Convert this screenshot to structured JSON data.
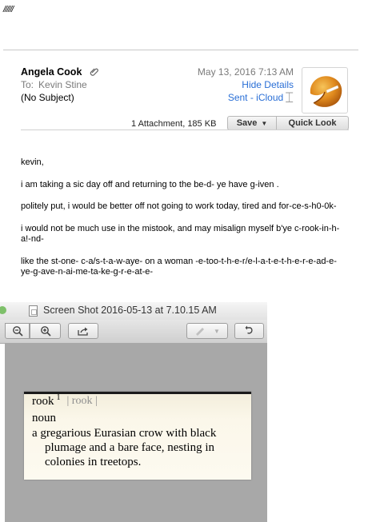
{
  "page_marks": "//////",
  "email": {
    "sender": "Angela Cook",
    "to_label": "To:",
    "to_value": "Kevin Stine",
    "subject": "(No Subject)",
    "date": "May 13, 2016",
    "time": "7:13 AM",
    "hide_details": "Hide Details",
    "sent_folder": "Sent - iCloud",
    "attachment_info": "1 Attachment, 185 KB",
    "save_label": "Save",
    "quick_look_label": "Quick Look",
    "body": [
      "kevin,",
      "i am taking a sic day off and returning to the  be-d- ye have g-iven .",
      "politely put, i would be better off not going to work today, tired and for-ce-s-h0-0k-",
      "i would not be much use in the mistook, and may misalign myself b'ye c-rook-in-h-a!-nd-",
      "like the st-one- c-a/s-t-a-w-aye- on a woman -e-too-t-h-e-r/e-l-a-t-e-t-h-e-r-e-ad-e-ye-g-ave-n-ai-me-ta-ke-g-r-e-at-e-"
    ]
  },
  "preview_window": {
    "title": "Screen Shot 2016-05-13 at 7.10.15 AM",
    "dictionary": {
      "headword": "rook",
      "superscript": "1",
      "pronunciation": "| rook |",
      "part_of_speech": "noun",
      "definition": "a gregarious Eurasian crow with black plumage and a bare face, nesting in colonies in treetops."
    }
  },
  "colors": {
    "link": "#2a6fd6",
    "muted_text": "#7a7a7a",
    "canvas_gray": "#a8a8a8",
    "dictionary_paper": "#fbf7ea"
  }
}
